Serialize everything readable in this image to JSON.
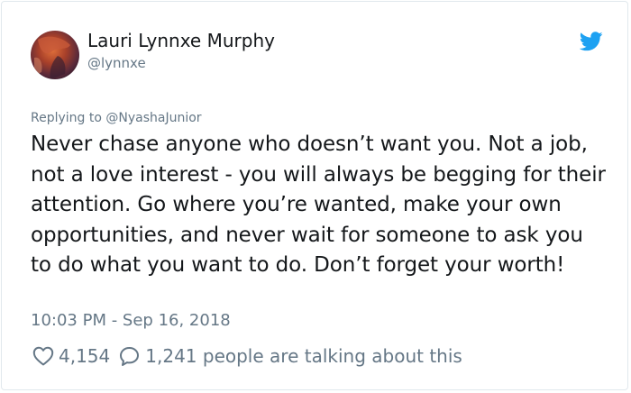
{
  "author": {
    "name": "Lauri Lynnxe Murphy",
    "handle": "@lynnxe"
  },
  "reply": {
    "text": "Replying to @NyashaJunior"
  },
  "tweet": {
    "text": "Never chase anyone who doesn’t want you. Not a job, not a love interest - you will always be begging for their attention. Go where you’re wanted, make your own opportunities, and never wait for someone to ask you to do what you want to do. Don’t forget your worth!",
    "timestamp": "10:03 PM - Sep 16, 2018"
  },
  "stats": {
    "likes": "4,154",
    "talking": "1,241 people are talking about this"
  },
  "icons": {
    "brand": "twitter-bird-icon",
    "like": "heart-icon",
    "reply": "speech-bubble-icon"
  },
  "colors": {
    "brand": "#1da1f2",
    "muted": "#657786",
    "text": "#14171a"
  }
}
